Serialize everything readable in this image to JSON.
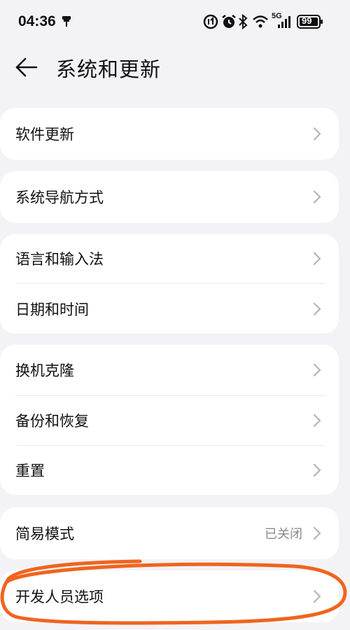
{
  "status_bar": {
    "time": "04:36",
    "network_label": "5G",
    "battery": "99",
    "icons": [
      "usb-icon",
      "data-saver-icon",
      "alarm-icon",
      "bluetooth-icon",
      "wifi-icon",
      "signal-icon",
      "battery-icon"
    ]
  },
  "header": {
    "title": "系统和更新",
    "back_icon": "arrow-left-icon"
  },
  "groups": [
    {
      "items": [
        {
          "label": "软件更新"
        }
      ]
    },
    {
      "items": [
        {
          "label": "系统导航方式"
        }
      ]
    },
    {
      "items": [
        {
          "label": "语言和输入法"
        },
        {
          "label": "日期和时间"
        }
      ]
    },
    {
      "items": [
        {
          "label": "换机克隆"
        },
        {
          "label": "备份和恢复"
        },
        {
          "label": "重置"
        }
      ]
    },
    {
      "items": [
        {
          "label": "简易模式",
          "value": "已关闭"
        }
      ]
    },
    {
      "items": [
        {
          "label": "开发人员选项"
        }
      ]
    }
  ],
  "annotation": {
    "shape": "hand-drawn-ellipse",
    "color": "#f0641e",
    "target": "开发人员选项"
  },
  "colors": {
    "background": "#f3f3f7",
    "card": "#ffffff",
    "chevron": "#b5b5b8",
    "secondary_text": "#8a8a8a"
  }
}
